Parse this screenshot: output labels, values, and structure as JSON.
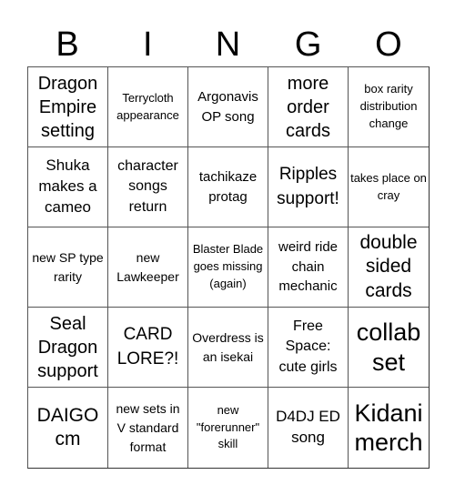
{
  "header": {
    "letters": [
      "B",
      "I",
      "N",
      "G",
      "O"
    ]
  },
  "cells": [
    "Dragon Empire setting",
    "Terrycloth appearance",
    "Argonavis OP song",
    "more order cards",
    "box rarity distribution change",
    "Shuka makes a cameo",
    "character songs return",
    "tachikaze protag",
    "Ripples support!",
    "takes place on cray",
    "new SP type rarity",
    "new Lawkeeper",
    "Blaster Blade goes missing (again)",
    "weird ride chain mechanic",
    "double sided cards",
    "Seal Dragon support",
    "CARD LORE?!",
    "Overdress is an isekai",
    "Free Space: cute girls",
    "collab set",
    "DAIGO cm",
    "new sets in V standard format",
    "new \"forerunner\" skill",
    "D4DJ ED song",
    "Kidani merch"
  ]
}
